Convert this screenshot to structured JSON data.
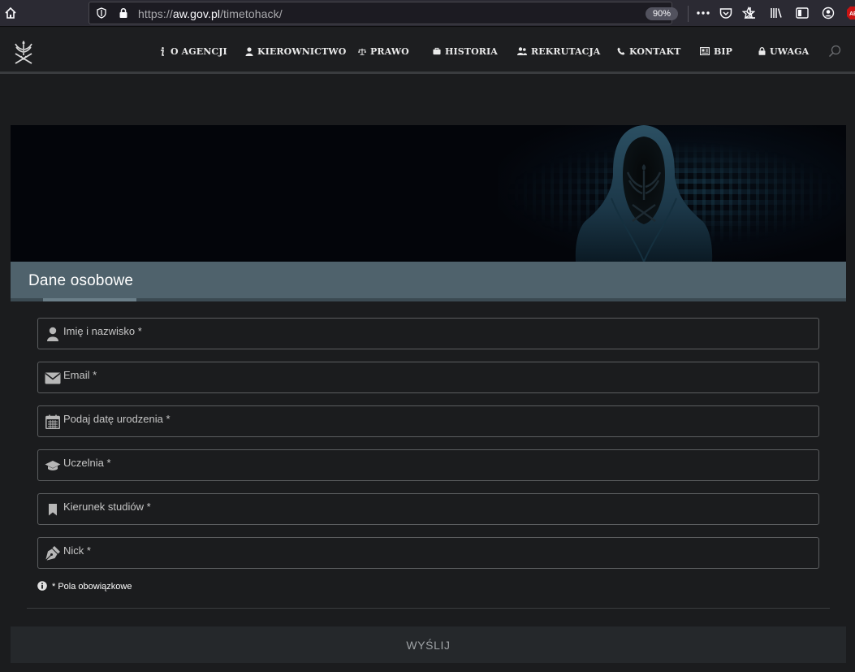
{
  "browser": {
    "url_scheme": "https://",
    "url_host": "aw.gov.pl",
    "url_path": "/timetohack/",
    "zoom": "90%"
  },
  "nav": {
    "items": [
      {
        "label": "O AGENCJI",
        "icon": "info-icon"
      },
      {
        "label": "KIEROWNICTWO",
        "icon": "user-icon"
      },
      {
        "label": "PRAWO",
        "icon": "scales-icon"
      },
      {
        "label": "HISTORIA",
        "icon": "briefcase-icon"
      },
      {
        "label": "REKRUTACJA",
        "icon": "users-icon"
      },
      {
        "label": "KONTAKT",
        "icon": "phone-icon"
      },
      {
        "label": "BIP",
        "icon": "newspaper-icon"
      },
      {
        "label": "UWAGA",
        "icon": "lock-icon"
      }
    ]
  },
  "form": {
    "title": "Dane osobowe",
    "fields": [
      {
        "placeholder": "Imię i nazwisko *",
        "value": "",
        "icon": "user-icon"
      },
      {
        "placeholder": "Email *",
        "value": "",
        "icon": "envelope-icon"
      },
      {
        "placeholder": "Podaj datę urodzenia *",
        "value": "",
        "icon": "calendar-icon"
      },
      {
        "placeholder": "Uczelnia *",
        "value": "",
        "icon": "graduation-cap-icon"
      },
      {
        "placeholder": "Kierunek studiów *",
        "value": "",
        "icon": "bookmark-icon"
      },
      {
        "placeholder": "Nick *",
        "value": "",
        "icon": "pen-nib-icon"
      }
    ],
    "required_note": "* Pola obowiązkowe",
    "submit_label": "WYŚLIJ"
  },
  "colors": {
    "page_bg": "#1b1c1e",
    "section_header": "#4f626c",
    "field_border": "#5c5e60",
    "submit_bg": "#25282b"
  }
}
